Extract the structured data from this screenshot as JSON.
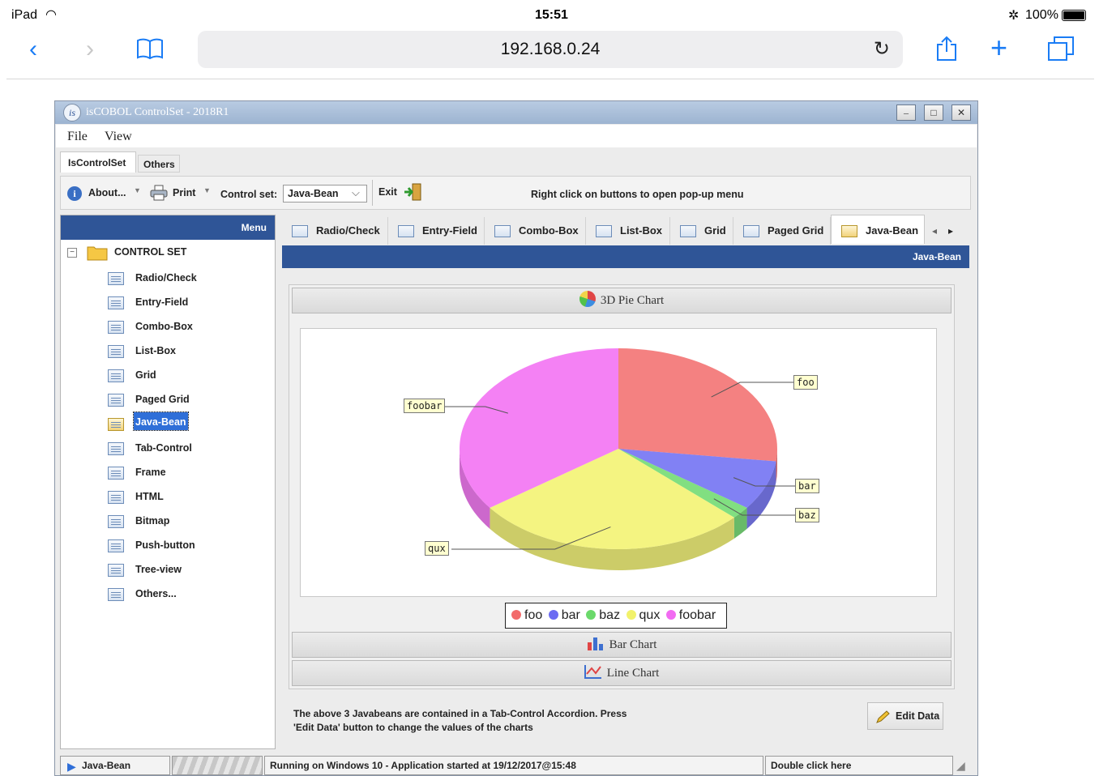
{
  "ios": {
    "device": "iPad",
    "time": "15:51",
    "battery": "100%",
    "url": "192.168.0.24"
  },
  "window": {
    "title": "isCOBOL ControlSet - 2018R1",
    "menu": [
      "File",
      "View"
    ],
    "top_tabs": [
      "IsControlSet",
      "Others"
    ],
    "toolbar": {
      "about": "About...",
      "print": "Print",
      "control_set_label": "Control set:",
      "control_set_value": "Java-Bean",
      "exit": "Exit",
      "hint": "Right click on buttons to open pop-up menu"
    }
  },
  "sidebar": {
    "header": "Menu",
    "root": "CONTROL SET",
    "items": [
      "Radio/Check",
      "Entry-Field",
      "Combo-Box",
      "List-Box",
      "Grid",
      "Paged Grid",
      "Java-Bean",
      "Tab-Control",
      "Frame",
      "HTML",
      "Bitmap",
      "Push-button",
      "Tree-view",
      "Others..."
    ],
    "selected": "Java-Bean"
  },
  "tabs": [
    "Radio/Check",
    "Entry-Field",
    "Combo-Box",
    "List-Box",
    "Grid",
    "Paged Grid",
    "Java-Bean"
  ],
  "panel_header": "Java-Bean",
  "accordion": {
    "pie_title": "3D Pie Chart",
    "bar_title": "Bar Chart",
    "line_title": "Line Chart"
  },
  "chart_data": {
    "type": "pie",
    "labels": [
      "foo",
      "bar",
      "baz",
      "qux",
      "foobar"
    ],
    "values": [
      27,
      8,
      2,
      28,
      35
    ],
    "colors": [
      "#f26b6b",
      "#6b6bf2",
      "#6bd96b",
      "#f2f26b",
      "#f26bf2"
    ]
  },
  "info": "The above 3 Javabeans are contained in a Tab-Control Accordion. Press 'Edit Data' button to change the values of the charts",
  "edit_button": "Edit Data",
  "status": {
    "left": "Java-Bean",
    "middle": "Running on Windows 10  -  Application started at 19/12/2017@15:48",
    "right": "Double click here"
  }
}
